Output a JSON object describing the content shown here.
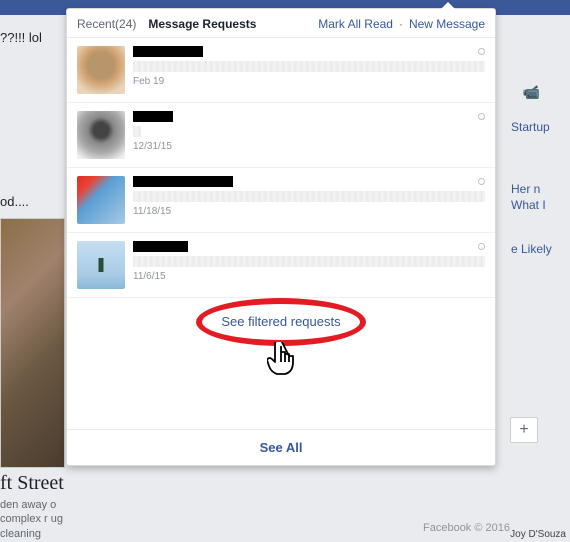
{
  "bg": {
    "left_text1": "??!!! lol",
    "left_text2": "od....",
    "street_title": "ft Street",
    "street_desc": "den away o complex r ug cleaning",
    "right1": "Startup",
    "right2": "Her n What I",
    "right3": "e Likely",
    "plus": "+",
    "footer": "Facebook © 2016",
    "credit": "Joy D'Souza"
  },
  "panel": {
    "tabs": {
      "recent_label": "Recent",
      "recent_count": "(24)",
      "requests_label": "Message Requests"
    },
    "actions": {
      "mark_all": "Mark All Read",
      "new_msg": "New Message"
    },
    "messages": [
      {
        "date": "Feb 19"
      },
      {
        "date": "12/31/15"
      },
      {
        "date": "11/18/15"
      },
      {
        "date": "11/6/15"
      }
    ],
    "filtered_label": "See filtered requests",
    "see_all": "See All"
  }
}
